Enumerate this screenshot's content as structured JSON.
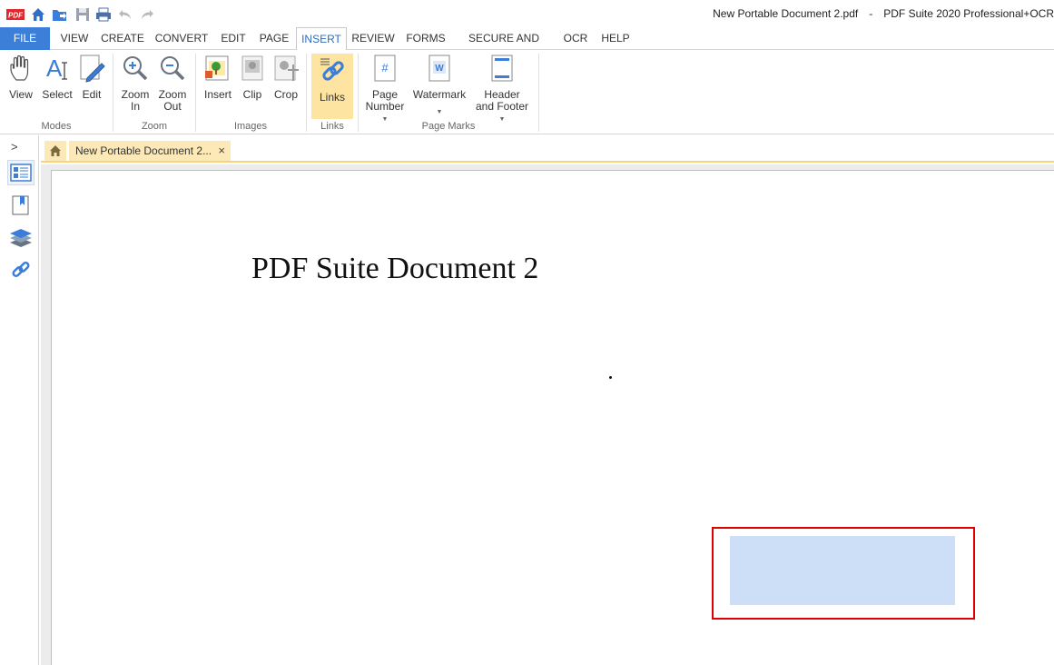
{
  "titlebar": {
    "document_name": "New Portable Document 2.pdf",
    "separator": "-",
    "app_name": "PDF Suite 2020  Professional+OCR",
    "quick_access": [
      "pdf-logo-icon",
      "home-icon",
      "open-folder-icon",
      "save-icon",
      "print-icon",
      "undo-icon",
      "redo-icon"
    ]
  },
  "menu": {
    "file": "FILE",
    "items": [
      "VIEW",
      "CREATE",
      "CONVERT",
      "EDIT",
      "PAGE",
      "INSERT",
      "REVIEW",
      "FORMS",
      "SECURE AND SIGN",
      "OCR",
      "HELP"
    ],
    "active": "INSERT"
  },
  "ribbon": {
    "modes": {
      "label": "Modes",
      "view": "View",
      "select": "Select",
      "edit": "Edit"
    },
    "zoom": {
      "label": "Zoom",
      "zoom_in_1": "Zoom",
      "zoom_in_2": "In",
      "zoom_out_1": "Zoom",
      "zoom_out_2": "Out"
    },
    "images": {
      "label": "Images",
      "insert": "Insert",
      "clip": "Clip",
      "crop": "Crop"
    },
    "links": {
      "label": "Links",
      "links": "Links"
    },
    "page_marks": {
      "label": "Page Marks",
      "page_number_1": "Page",
      "page_number_2": "Number",
      "watermark": "Watermark",
      "header_footer_1": "Header",
      "header_footer_2": "and Footer"
    }
  },
  "left_panel": {
    "expand": ">",
    "icons": [
      "thumbnails-icon",
      "bookmarks-icon",
      "layers-icon",
      "links-panel-icon"
    ]
  },
  "tabs": {
    "document_tab": "New Portable Document 2...",
    "close": "×"
  },
  "document": {
    "title": "PDF Suite Document 2"
  },
  "colors": {
    "file_tab": "#3c7fd8",
    "active_menu_text": "#2d6dc0",
    "ribbon_highlight": "#fde4a0",
    "tab_background": "#fde9b8",
    "link_border": "#e00000",
    "link_fill": "#ccdff7"
  }
}
